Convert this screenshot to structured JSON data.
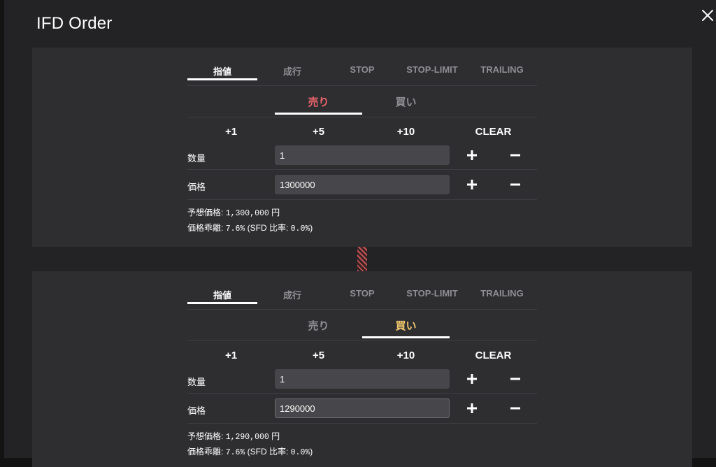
{
  "dialog": {
    "title": "IFD Order"
  },
  "order_types": [
    "指値",
    "成行",
    "STOP",
    "STOP-LIMIT",
    "TRAILING"
  ],
  "quick_buttons": [
    "+1",
    "+5",
    "+10",
    "CLEAR"
  ],
  "colors": {
    "sell": "#e8646a",
    "buy": "#f0c86e",
    "panel": "#2e2e31",
    "background": "#232326"
  },
  "icons": {
    "close": "close-icon",
    "plus": "plus-icon",
    "minus": "minus-icon"
  },
  "orders": [
    {
      "active_type": "指値",
      "sides": {
        "sell": "売り",
        "buy": "買い"
      },
      "active_side": "sell",
      "quantity": {
        "label": "数量",
        "value": "1"
      },
      "price": {
        "label": "価格",
        "value": "1300000"
      },
      "expected_price": {
        "label": "予想価格:",
        "value": "1,300,000",
        "unit": "円"
      },
      "deviation": {
        "label": "価格乖離:",
        "value": "7.6%",
        "sfd_label": "(SFD 比率:",
        "sfd_value": "0.0%",
        "close": ")"
      }
    },
    {
      "active_type": "指値",
      "sides": {
        "sell": "売り",
        "buy": "買い"
      },
      "active_side": "buy",
      "quantity": {
        "label": "数量",
        "value": "1"
      },
      "price": {
        "label": "価格",
        "value": "1290000"
      },
      "expected_price": {
        "label": "予想価格:",
        "value": "1,290,000",
        "unit": "円"
      },
      "deviation": {
        "label": "価格乖離:",
        "value": "7.6%",
        "sfd_label": "(SFD 比率:",
        "sfd_value": "0.0%",
        "close": ")"
      }
    }
  ]
}
